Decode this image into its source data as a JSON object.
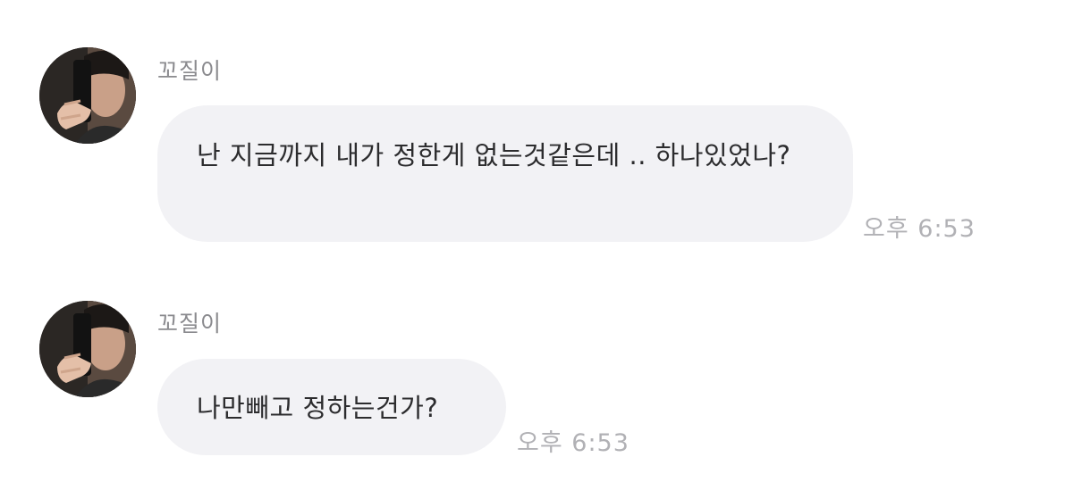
{
  "messages": [
    {
      "sender": "꼬질이",
      "text": "난 지금까지 내가 정한게 없는것같은데 .. 하나있었나?",
      "time": "오후 6:53"
    },
    {
      "sender": "꼬질이",
      "text": "나만빼고 정하는건가?",
      "time": "오후 6:53"
    }
  ],
  "colors": {
    "bubble_background": "#f2f2f5",
    "sender_text": "#8a8a8e",
    "message_text": "#2c2c2e",
    "timestamp_text": "#b1b1b5"
  },
  "icons": {
    "avatar": "profile-photo-icon"
  }
}
